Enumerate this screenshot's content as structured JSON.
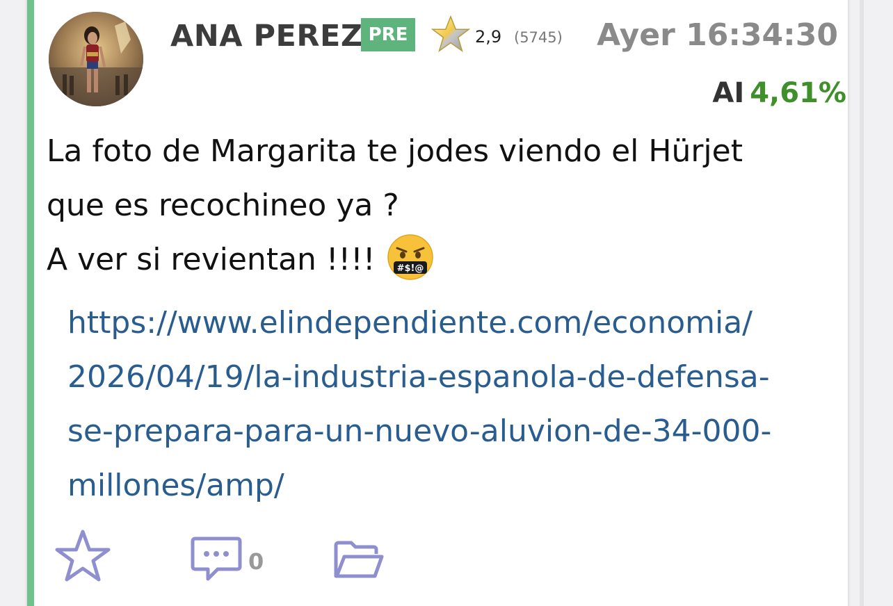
{
  "post": {
    "author": {
      "name": "ANA PEREZ",
      "badge": "PRE",
      "rating": "2,9",
      "rating_count": "(5745)"
    },
    "timestamp": "Ayer 16:34:30",
    "ai": {
      "label": "AI",
      "value": "4,61%"
    },
    "message_lines": [
      "La foto de Margarita te jodes viendo el Hürjet",
      "que es recochineo ya ?",
      "A ver si revientan !!!!"
    ],
    "emoji": "face-with-symbols-on-mouth",
    "link_lines": [
      "https://www.elindependiente.com/economia/",
      "2026/04/19/la-industria-espanola-de-defensa-",
      "se-prepara-para-un-nuevo-aluvion-de-34-000-",
      "millones/amp/"
    ],
    "actions": {
      "comment_count": "0"
    }
  },
  "colors": {
    "accent_bar": "#6fc28b",
    "badge": "#5fb47e",
    "ai_value": "#3f8f2a",
    "link": "#2a5d8f",
    "action_icons": "#8f8fcf"
  },
  "icons": [
    "avatar-image",
    "star-rating-icon",
    "face-with-symbols-emoji",
    "favorite-star-icon",
    "comment-icon",
    "folder-icon"
  ]
}
